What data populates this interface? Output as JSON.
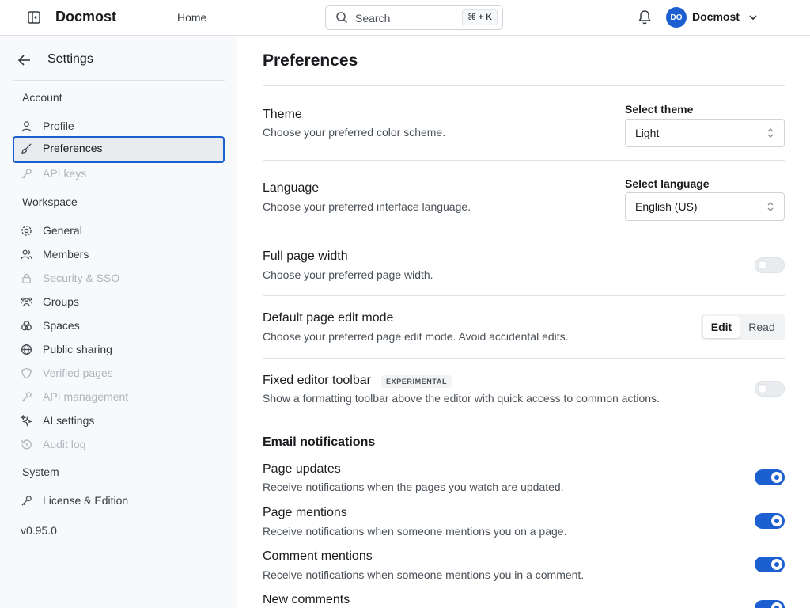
{
  "header": {
    "brand": "Docmost",
    "home": "Home",
    "search_placeholder": "Search",
    "search_shortcut": "⌘ + K",
    "avatar_initials": "DO",
    "user_name": "Docmost"
  },
  "sidebar": {
    "title": "Settings",
    "sections": {
      "account": "Account",
      "workspace": "Workspace",
      "system": "System"
    },
    "account_items": [
      {
        "label": "Profile",
        "icon": "user-icon",
        "disabled": false
      },
      {
        "label": "Preferences",
        "icon": "brush-icon",
        "active": true
      },
      {
        "label": "API keys",
        "icon": "key-icon",
        "disabled": true
      }
    ],
    "workspace_items": [
      {
        "label": "General",
        "icon": "gear-icon"
      },
      {
        "label": "Members",
        "icon": "users-icon"
      },
      {
        "label": "Security & SSO",
        "icon": "lock-icon",
        "disabled": true
      },
      {
        "label": "Groups",
        "icon": "groups-icon"
      },
      {
        "label": "Spaces",
        "icon": "spaces-icon"
      },
      {
        "label": "Public sharing",
        "icon": "globe-icon"
      },
      {
        "label": "Verified pages",
        "icon": "shield-icon",
        "disabled": true
      },
      {
        "label": "API management",
        "icon": "key-icon",
        "disabled": true
      },
      {
        "label": "AI settings",
        "icon": "sparkles-icon"
      },
      {
        "label": "Audit log",
        "icon": "history-icon",
        "disabled": true
      }
    ],
    "system_items": [
      {
        "label": "License & Edition",
        "icon": "key-icon"
      }
    ],
    "version": "v0.95.0"
  },
  "main": {
    "title": "Preferences",
    "theme": {
      "title": "Theme",
      "desc": "Choose your preferred color scheme.",
      "select_label": "Select theme",
      "value": "Light"
    },
    "language": {
      "title": "Language",
      "desc": "Choose your preferred interface language.",
      "select_label": "Select language",
      "value": "English (US)"
    },
    "full_width": {
      "title": "Full page width",
      "desc": "Choose your preferred page width.",
      "enabled": false
    },
    "edit_mode": {
      "title": "Default page edit mode",
      "desc": "Choose your preferred page edit mode. Avoid accidental edits.",
      "options": [
        "Edit",
        "Read"
      ],
      "selected": "Edit"
    },
    "toolbar": {
      "title": "Fixed editor toolbar",
      "badge": "EXPERIMENTAL",
      "desc": "Show a formatting toolbar above the editor with quick access to common actions.",
      "enabled": false
    },
    "email": {
      "section_title": "Email notifications",
      "items": [
        {
          "title": "Page updates",
          "desc": "Receive notifications when the pages you watch are updated.",
          "enabled": true
        },
        {
          "title": "Page mentions",
          "desc": "Receive notifications when someone mentions you on a page.",
          "enabled": true
        },
        {
          "title": "Comment mentions",
          "desc": "Receive notifications when someone mentions you in a comment.",
          "enabled": true
        },
        {
          "title": "New comments",
          "desc": "",
          "enabled": true
        }
      ]
    }
  },
  "colors": {
    "accent": "#1c5fd0",
    "sidebar_bg": "#f8f9fa",
    "disabled_text": "#adb5bd"
  }
}
